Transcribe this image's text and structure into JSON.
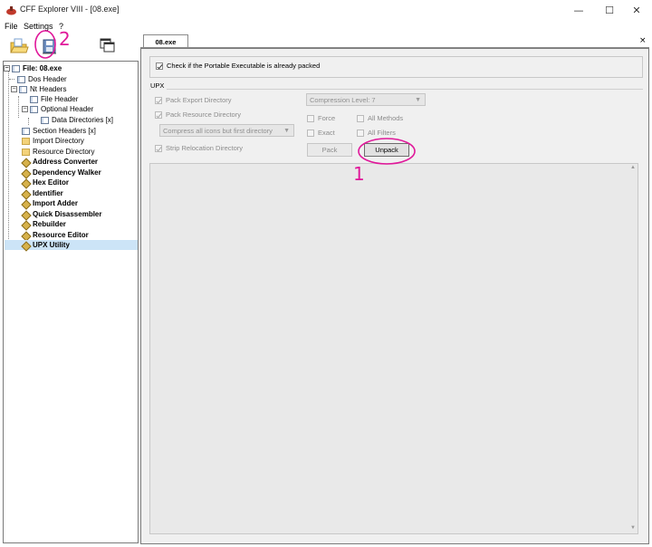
{
  "window": {
    "title": "CFF Explorer VIII - [08.exe]"
  },
  "menu": [
    "File",
    "Settings",
    "?"
  ],
  "tree": {
    "nodes": [
      {
        "label": "File: 08.exe"
      },
      {
        "label": "Dos Header"
      },
      {
        "label": "Nt Headers"
      },
      {
        "label": "File Header"
      },
      {
        "label": "Optional Header"
      },
      {
        "label": "Data Directories [x]"
      },
      {
        "label": "Section Headers [x]"
      },
      {
        "label": "Import Directory"
      },
      {
        "label": "Resource Directory"
      },
      {
        "label": "Address Converter"
      },
      {
        "label": "Dependency Walker"
      },
      {
        "label": "Hex Editor"
      },
      {
        "label": "Identifier"
      },
      {
        "label": "Import Adder"
      },
      {
        "label": "Quick Disassembler"
      },
      {
        "label": "Rebuilder"
      },
      {
        "label": "Resource Editor"
      },
      {
        "label": "UPX Utility"
      }
    ]
  },
  "tab": {
    "label": "08.exe",
    "close": "×"
  },
  "upx": {
    "check_packed": "Check if the Portable Executable is already packed",
    "group_label": "UPX",
    "pack_export": "Pack Export Directory",
    "pack_resource": "Pack Resource Directory",
    "icons_combo": "Compress all icons but first directory",
    "strip_reloc": "Strip Relocation Directory",
    "compression_combo": "Compression Level: 7",
    "force": "Force",
    "all_methods": "All Methods",
    "exact": "Exact",
    "all_filters": "All Filters",
    "pack_button": "Pack",
    "unpack_button": "Unpack"
  },
  "annotations": {
    "one": "1",
    "two": "2"
  },
  "colors": {
    "annotation": "#e0189a",
    "selection": "#cce4f7"
  }
}
